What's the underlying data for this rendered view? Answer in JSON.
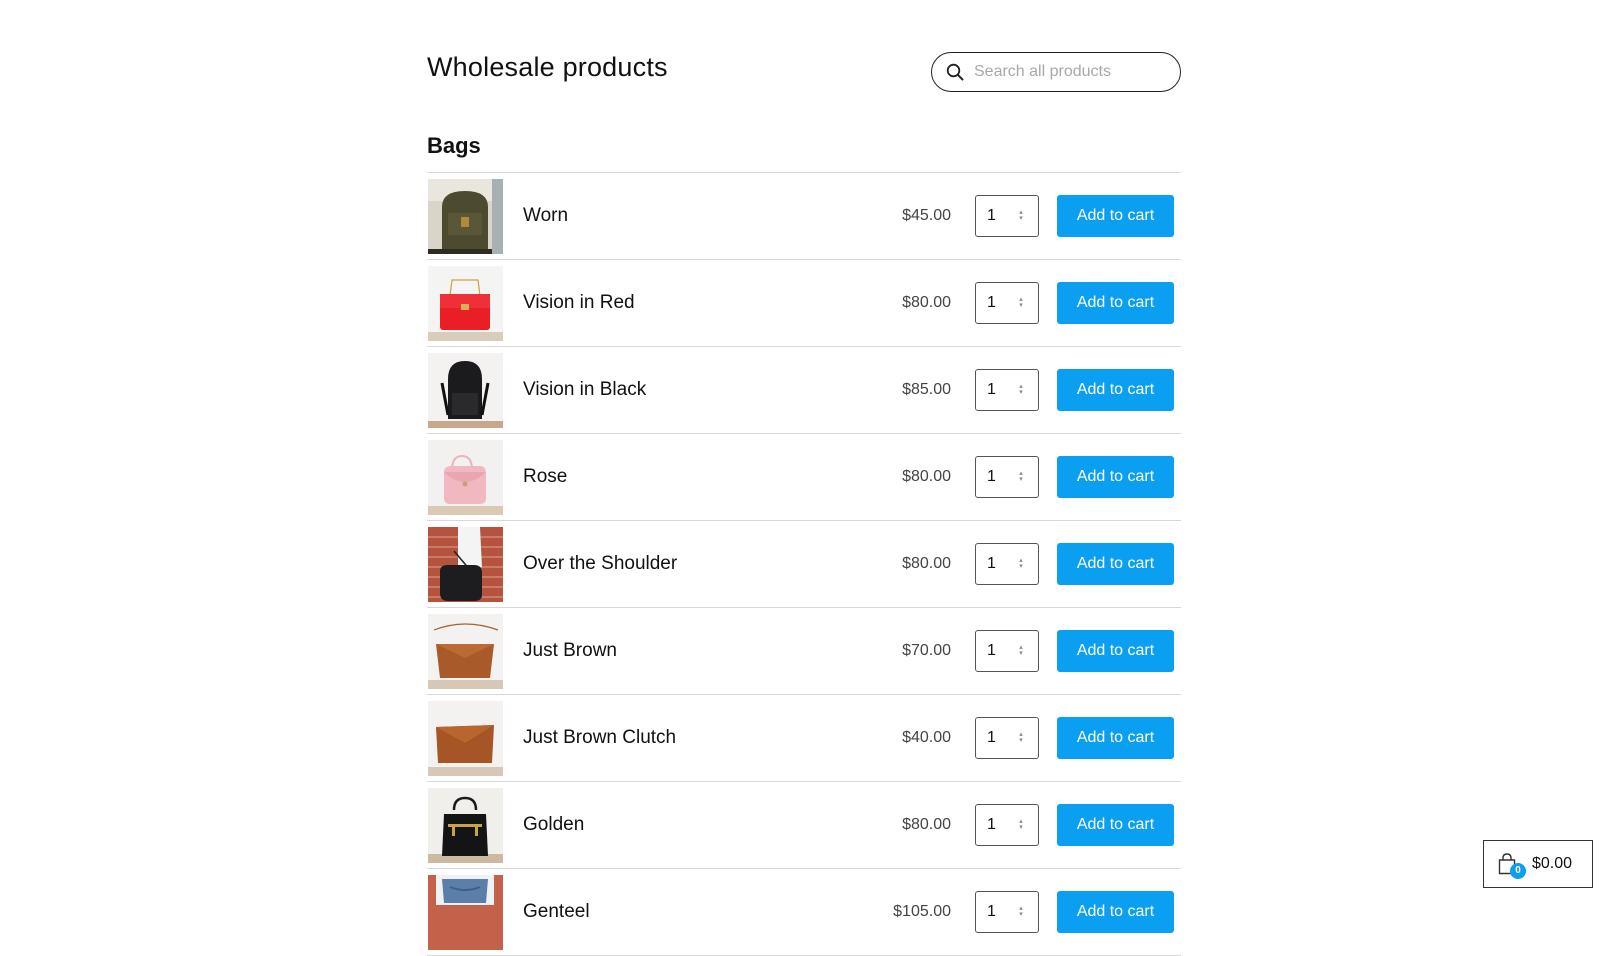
{
  "page_title": "Wholesale products",
  "search": {
    "placeholder": "Search all products",
    "value": ""
  },
  "section_title": "Bags",
  "add_label": "Add to cart",
  "products": [
    {
      "name": "Worn",
      "price": "$45.00",
      "qty": "1",
      "image": "olive-backpack"
    },
    {
      "name": "Vision in Red",
      "price": "$80.00",
      "qty": "1",
      "image": "red-handbag"
    },
    {
      "name": "Vision in Black",
      "price": "$85.00",
      "qty": "1",
      "image": "black-backpack"
    },
    {
      "name": "Rose",
      "price": "$80.00",
      "qty": "1",
      "image": "pink-handbag"
    },
    {
      "name": "Over the Shoulder",
      "price": "$80.00",
      "qty": "1",
      "image": "shoulder-bag-brick-wall"
    },
    {
      "name": "Just Brown",
      "price": "$70.00",
      "qty": "1",
      "image": "brown-bag"
    },
    {
      "name": "Just Brown Clutch",
      "price": "$40.00",
      "qty": "1",
      "image": "brown-clutch"
    },
    {
      "name": "Golden",
      "price": "$80.00",
      "qty": "1",
      "image": "black-gold-backpack"
    },
    {
      "name": "Genteel",
      "price": "$105.00",
      "qty": "1",
      "image": "bag-with-jeans"
    }
  ],
  "cart": {
    "count": "0",
    "total": "$0.00"
  },
  "colors": {
    "accent": "#0a9ff0",
    "divider": "#d8d8d8"
  }
}
